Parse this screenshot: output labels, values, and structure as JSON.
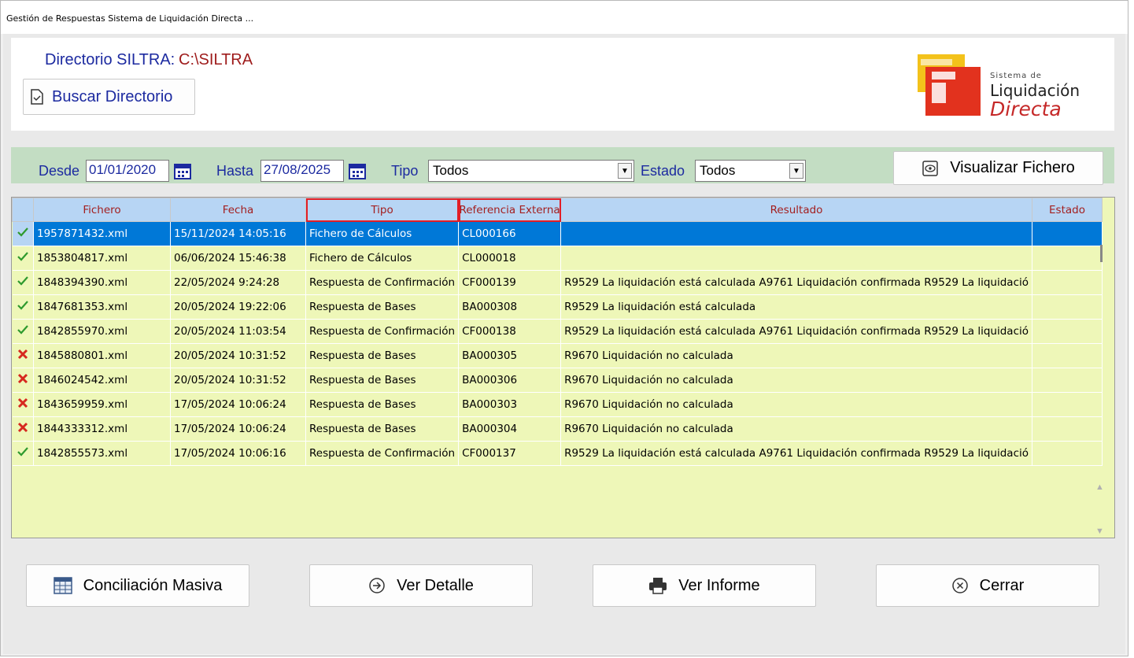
{
  "window": {
    "title": "Gestión de Respuestas Sistema de Liquidación Directa ..."
  },
  "header": {
    "dir_label": "Directorio SILTRA:",
    "dir_value": "C:\\SILTRA",
    "buscar_label": "Buscar Directorio",
    "logo": {
      "line1": "Sistema de",
      "line2": "Liquidación",
      "line3": "Directa"
    }
  },
  "filters": {
    "desde_label": "Desde",
    "desde_value": "01/01/2020",
    "hasta_label": "Hasta",
    "hasta_value": "27/08/2025",
    "tipo_label": "Tipo",
    "tipo_value": "Todos",
    "estado_label": "Estado",
    "estado_value": "Todos",
    "visualizar_label": "Visualizar Fichero",
    "visualizar_hotkey": "F"
  },
  "grid": {
    "columns": [
      "Fichero",
      "Fecha",
      "Tipo",
      "Referencia Externa",
      "Resultado",
      "Estado"
    ],
    "rows": [
      {
        "status": "ok",
        "fichero": "1957871432.xml",
        "fecha": "15/11/2024 14:05:16",
        "tipo": "Fichero de Cálculos",
        "ref": "CL000166",
        "resultado": "",
        "estado": "",
        "selected": true
      },
      {
        "status": "ok",
        "fichero": "1853804817.xml",
        "fecha": "06/06/2024 15:46:38",
        "tipo": "Fichero de Cálculos",
        "ref": "CL000018",
        "resultado": "",
        "estado": ""
      },
      {
        "status": "ok",
        "fichero": "1848394390.xml",
        "fecha": "22/05/2024 9:24:28",
        "tipo": "Respuesta de Confirmación",
        "ref": "CF000139",
        "resultado": "R9529 La liquidación está calculada A9761 Liquidación confirmada R9529 La liquidació",
        "estado": ""
      },
      {
        "status": "ok",
        "fichero": "1847681353.xml",
        "fecha": "20/05/2024 19:22:06",
        "tipo": "Respuesta de Bases",
        "ref": "BA000308",
        "resultado": "R9529 La liquidación está calculada",
        "estado": ""
      },
      {
        "status": "ok",
        "fichero": "1842855970.xml",
        "fecha": "20/05/2024 11:03:54",
        "tipo": "Respuesta de Confirmación",
        "ref": "CF000138",
        "resultado": "R9529 La liquidación está calculada A9761 Liquidación confirmada R9529 La liquidació",
        "estado": ""
      },
      {
        "status": "err",
        "fichero": "1845880801.xml",
        "fecha": "20/05/2024 10:31:52",
        "tipo": "Respuesta de Bases",
        "ref": "BA000305",
        "resultado": "R9670 Liquidación no calculada",
        "estado": ""
      },
      {
        "status": "err",
        "fichero": "1846024542.xml",
        "fecha": "20/05/2024 10:31:52",
        "tipo": "Respuesta de Bases",
        "ref": "BA000306",
        "resultado": "R9670 Liquidación no calculada",
        "estado": ""
      },
      {
        "status": "err",
        "fichero": "1843659959.xml",
        "fecha": "17/05/2024 10:06:24",
        "tipo": "Respuesta de Bases",
        "ref": "BA000303",
        "resultado": "R9670 Liquidación no calculada",
        "estado": ""
      },
      {
        "status": "err",
        "fichero": "1844333312.xml",
        "fecha": "17/05/2024 10:06:24",
        "tipo": "Respuesta de Bases",
        "ref": "BA000304",
        "resultado": "R9670 Liquidación no calculada",
        "estado": ""
      },
      {
        "status": "ok",
        "fichero": "1842855573.xml",
        "fecha": "17/05/2024 10:06:16",
        "tipo": "Respuesta de Confirmación",
        "ref": "CF000137",
        "resultado": "R9529 La liquidación está calculada A9761 Liquidación confirmada R9529 La liquidació",
        "estado": ""
      }
    ]
  },
  "footer": {
    "conciliacion_label": "Conciliación Masiva",
    "detalle_label": "Ver Detalle",
    "informe_label": "Ver Informe",
    "cerrar_label": "Cerrar"
  },
  "colors": {
    "accent_blue": "#1c2aa0",
    "selection": "#0078d7",
    "header_red": "#a31f1f",
    "highlight": "#e21e26"
  }
}
